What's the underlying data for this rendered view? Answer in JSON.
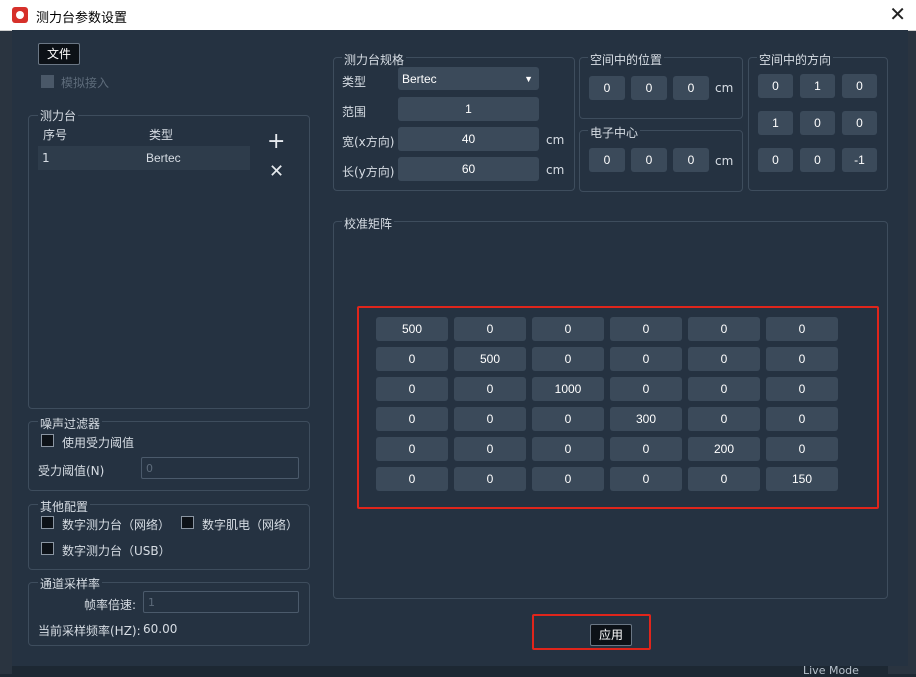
{
  "window": {
    "title": "测力台参数设置",
    "close": "✕"
  },
  "file_button": "文件",
  "simulate_label": "模拟接入",
  "plate_list": {
    "title": "测力台",
    "col_index": "序号",
    "col_type": "类型",
    "rows": [
      {
        "index": "1",
        "type": "Bertec"
      }
    ],
    "add_icon": "+",
    "remove_icon": "✕"
  },
  "noise_filter": {
    "title": "噪声过滤器",
    "use_threshold": "使用受力阈值",
    "threshold_label": "受力阈值(N)",
    "threshold_placeholder": "0"
  },
  "other_config": {
    "title": "其他配置",
    "digital_plate_net": "数字测力台（网络）",
    "digital_emg_net": "数字肌电（网络）",
    "digital_plate_usb": "数字测力台（USB）"
  },
  "sampling": {
    "title": "通道采样率",
    "multiplier_label": "帧率倍速:",
    "multiplier_placeholder": "1",
    "current_label": "当前采样频率(HZ):",
    "current_value": "60.00"
  },
  "spec": {
    "title": "测力台规格",
    "type_label": "类型",
    "type_value": "Bertec",
    "range_label": "范围",
    "range_value": "1",
    "width_label": "宽(x方向)",
    "width_value": "40",
    "width_unit": "cm",
    "length_label": "长(y方向)",
    "length_value": "60",
    "length_unit": "cm"
  },
  "position": {
    "title": "空间中的位置",
    "values": [
      "0",
      "0",
      "0"
    ],
    "unit": "cm"
  },
  "center": {
    "title": "电子中心",
    "values": [
      "0",
      "0",
      "0"
    ],
    "unit": "cm"
  },
  "orientation": {
    "title": "空间中的方向",
    "values": [
      [
        "0",
        "1",
        "0"
      ],
      [
        "1",
        "0",
        "0"
      ],
      [
        "0",
        "0",
        "-1"
      ]
    ]
  },
  "calibration": {
    "title": "校准矩阵",
    "matrix": [
      [
        "500",
        "0",
        "0",
        "0",
        "0",
        "0"
      ],
      [
        "0",
        "500",
        "0",
        "0",
        "0",
        "0"
      ],
      [
        "0",
        "0",
        "1000",
        "0",
        "0",
        "0"
      ],
      [
        "0",
        "0",
        "0",
        "300",
        "0",
        "0"
      ],
      [
        "0",
        "0",
        "0",
        "0",
        "200",
        "0"
      ],
      [
        "0",
        "0",
        "0",
        "0",
        "0",
        "150"
      ]
    ]
  },
  "apply_button": "应用",
  "background_text": "Live Mode",
  "colors": {
    "highlight": "#e0251b",
    "field_bg": "#3b4a5a",
    "panel_bg": "#253241"
  }
}
